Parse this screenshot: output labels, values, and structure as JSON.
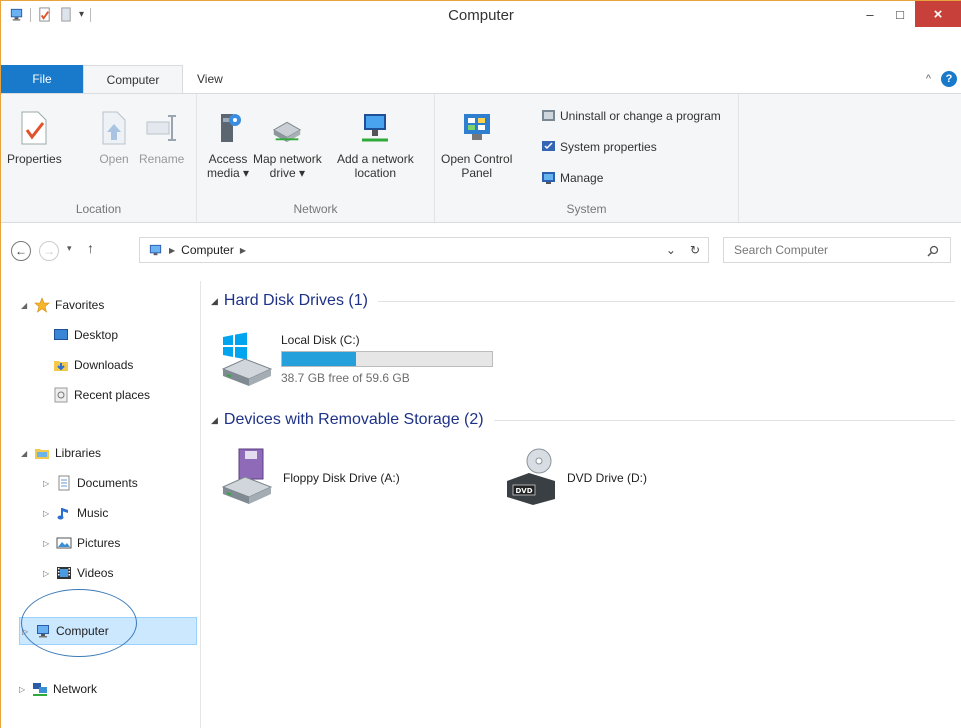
{
  "window": {
    "title": "Computer",
    "controls": {
      "minimize": "–",
      "maximize": "□",
      "close": "×"
    }
  },
  "ribbon": {
    "tabs": {
      "file": "File",
      "computer": "Computer",
      "view": "View"
    },
    "groups": {
      "location": {
        "label": "Location",
        "buttons": [
          {
            "label": "Properties",
            "icon": "properties-icon",
            "enabled": true
          },
          {
            "label": "Open",
            "icon": "open-icon",
            "enabled": false
          },
          {
            "label": "Rename",
            "icon": "rename-icon",
            "enabled": false
          }
        ]
      },
      "network": {
        "label": "Network",
        "buttons": [
          {
            "line1": "Access",
            "line2": "media ▾",
            "icon": "access-media-icon"
          },
          {
            "line1": "Map network",
            "line2": "drive ▾",
            "icon": "map-network-drive-icon"
          },
          {
            "line1": "Add a network",
            "line2": "location",
            "icon": "add-network-location-icon"
          }
        ]
      },
      "system": {
        "label": "System",
        "open_control_panel": {
          "line1": "Open Control",
          "line2": "Panel"
        },
        "small_buttons": [
          "Uninstall or change a program",
          "System properties",
          "Manage"
        ]
      }
    }
  },
  "address": {
    "path": "Computer",
    "search_placeholder": "Search Computer"
  },
  "nav": {
    "favorites": {
      "label": "Favorites",
      "items": [
        "Desktop",
        "Downloads",
        "Recent places"
      ]
    },
    "libraries": {
      "label": "Libraries",
      "items": [
        "Documents",
        "Music",
        "Pictures",
        "Videos"
      ]
    },
    "computer": "Computer",
    "network": "Network"
  },
  "content": {
    "hard_disks": {
      "heading": "Hard Disk Drives (1)",
      "drives": [
        {
          "name": "Local Disk (C:)",
          "free_text": "38.7 GB free of 59.6 GB",
          "used_fraction": 0.351
        }
      ]
    },
    "removable": {
      "heading": "Devices with Removable Storage (2)",
      "drives": [
        {
          "name": "Floppy Disk Drive (A:)"
        },
        {
          "name": "DVD Drive (D:)"
        }
      ]
    }
  },
  "colors": {
    "accent": "#1979ca",
    "close": "#c7413a",
    "selection": "#cce8ff",
    "bar": "#26a0da"
  }
}
